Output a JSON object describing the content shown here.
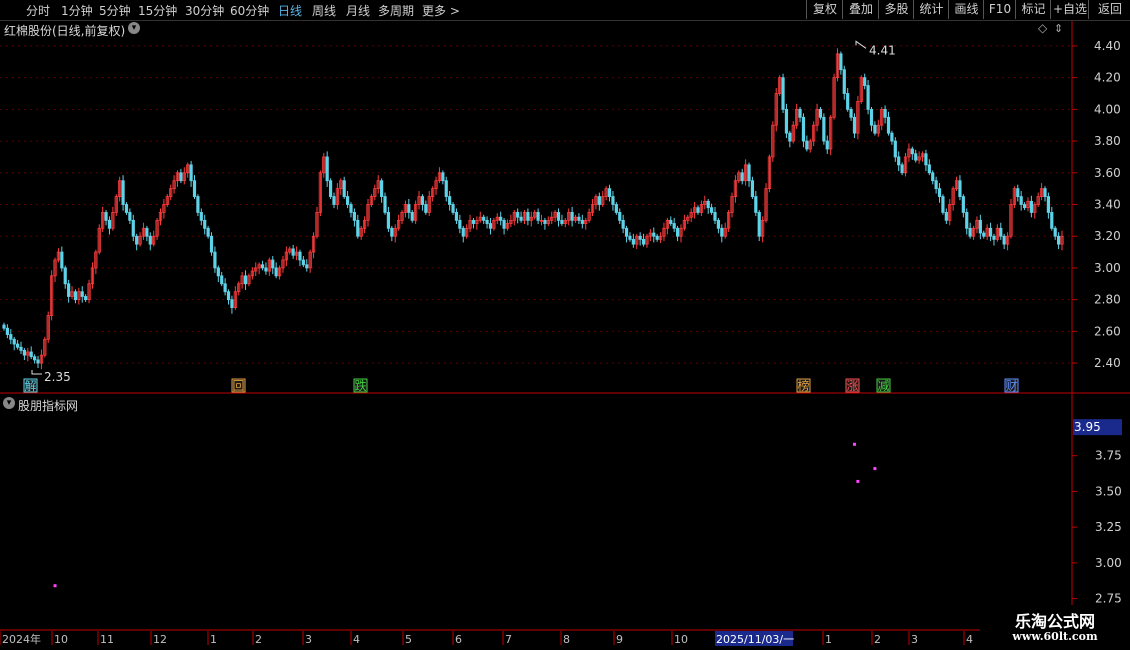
{
  "periods": [
    "分时",
    "1分钟",
    "5分钟",
    "15分钟",
    "30分钟",
    "60分钟",
    "日线",
    "周线",
    "月线",
    "多周期",
    "更多"
  ],
  "active_period": "日线",
  "more_arrow": ">",
  "right_buttons": [
    "复权",
    "叠加",
    "多股",
    "统计",
    "画线",
    "F10",
    "标记",
    "+自选",
    "返回"
  ],
  "main_title": "红棉股份(日线,前复权)",
  "sub_title": "股朋指标网",
  "colors": {
    "up": "#ff3c3c",
    "down": "#5fd3e8",
    "axis": "#c00000",
    "magenta": "#ff44ff",
    "highlight": "#1a2a8c"
  },
  "main_axis_labels": [
    "4.40",
    "4.20",
    "4.00",
    "3.80",
    "3.60",
    "3.40",
    "3.20",
    "3.00",
    "2.80",
    "2.60",
    "2.40"
  ],
  "sub_axis_labels": [
    "3.75",
    "3.50",
    "3.25",
    "3.00",
    "2.75"
  ],
  "sub_current_value": "3.95",
  "high_label": "4.41",
  "low_label": "2.35",
  "event_markers": [
    {
      "text": "解",
      "color": "#5fd3e8"
    },
    {
      "text": "回",
      "color": "#e0a040"
    },
    {
      "text": "跌",
      "color": "#40d040"
    },
    {
      "text": "榜",
      "color": "#e0a040"
    },
    {
      "text": "涨",
      "color": "#ff5050"
    },
    {
      "text": "减",
      "color": "#40d040"
    },
    {
      "text": "财",
      "color": "#6090ff"
    }
  ],
  "date_axis": [
    "2024年",
    "10",
    "11",
    "12",
    "1",
    "2",
    "3",
    "4",
    "5",
    "6",
    "7",
    "8",
    "9",
    "10",
    "2025/11/03/一",
    "1",
    "2",
    "3",
    "4"
  ],
  "watermark": {
    "title": "乐淘公式网",
    "url": "www.60lt.com"
  },
  "chart_data": [
    {
      "type": "candlestick",
      "title": "红棉股份(日线,前复权)",
      "ylim": [
        2.35,
        4.45
      ],
      "high": 4.41,
      "low": 2.35,
      "close_series": [
        2.62,
        2.58,
        2.55,
        2.52,
        2.5,
        2.48,
        2.45,
        2.47,
        2.44,
        2.42,
        2.4,
        2.45,
        2.55,
        2.7,
        2.95,
        3.05,
        3.1,
        3.0,
        2.9,
        2.82,
        2.85,
        2.8,
        2.85,
        2.82,
        2.8,
        2.9,
        3.0,
        3.1,
        3.25,
        3.35,
        3.3,
        3.25,
        3.35,
        3.45,
        3.55,
        3.4,
        3.35,
        3.3,
        3.2,
        3.15,
        3.2,
        3.25,
        3.2,
        3.15,
        3.2,
        3.3,
        3.35,
        3.4,
        3.45,
        3.5,
        3.55,
        3.6,
        3.55,
        3.6,
        3.65,
        3.55,
        3.45,
        3.35,
        3.3,
        3.25,
        3.2,
        3.1,
        3.0,
        2.95,
        2.9,
        2.85,
        2.8,
        2.75,
        2.85,
        2.9,
        2.95,
        2.9,
        2.95,
        2.98,
        3.0,
        3.02,
        3.0,
        2.98,
        3.05,
        3.0,
        2.95,
        3.0,
        3.05,
        3.1,
        3.12,
        3.08,
        3.1,
        3.05,
        3.02,
        3.0,
        3.1,
        3.2,
        3.35,
        3.6,
        3.7,
        3.55,
        3.45,
        3.4,
        3.5,
        3.55,
        3.45,
        3.4,
        3.35,
        3.3,
        3.2,
        3.25,
        3.3,
        3.4,
        3.45,
        3.5,
        3.55,
        3.45,
        3.35,
        3.25,
        3.2,
        3.25,
        3.3,
        3.35,
        3.4,
        3.35,
        3.3,
        3.4,
        3.45,
        3.4,
        3.35,
        3.45,
        3.5,
        3.55,
        3.6,
        3.55,
        3.45,
        3.4,
        3.35,
        3.3,
        3.25,
        3.2,
        3.25,
        3.3,
        3.28,
        3.3,
        3.32,
        3.3,
        3.28,
        3.25,
        3.3,
        3.32,
        3.3,
        3.25,
        3.28,
        3.3,
        3.35,
        3.32,
        3.3,
        3.35,
        3.3,
        3.32,
        3.35,
        3.3,
        3.3,
        3.28,
        3.3,
        3.32,
        3.35,
        3.3,
        3.28,
        3.3,
        3.35,
        3.3,
        3.32,
        3.3,
        3.28,
        3.3,
        3.35,
        3.4,
        3.45,
        3.4,
        3.45,
        3.5,
        3.45,
        3.4,
        3.35,
        3.3,
        3.25,
        3.2,
        3.18,
        3.15,
        3.2,
        3.18,
        3.15,
        3.2,
        3.22,
        3.2,
        3.18,
        3.2,
        3.25,
        3.3,
        3.28,
        3.25,
        3.2,
        3.25,
        3.3,
        3.32,
        3.35,
        3.38,
        3.35,
        3.4,
        3.42,
        3.38,
        3.35,
        3.3,
        3.25,
        3.2,
        3.25,
        3.35,
        3.45,
        3.55,
        3.6,
        3.55,
        3.65,
        3.55,
        3.45,
        3.35,
        3.2,
        3.3,
        3.5,
        3.7,
        3.9,
        4.1,
        4.2,
        4.0,
        3.85,
        3.8,
        3.9,
        4.0,
        3.95,
        3.8,
        3.75,
        3.8,
        3.9,
        4.0,
        3.95,
        3.8,
        3.75,
        3.95,
        4.2,
        4.35,
        4.25,
        4.1,
        4.0,
        3.95,
        3.85,
        4.05,
        4.2,
        4.15,
        4.0,
        3.9,
        3.85,
        3.9,
        4.0,
        3.95,
        3.85,
        3.8,
        3.7,
        3.65,
        3.6,
        3.7,
        3.75,
        3.72,
        3.68,
        3.7,
        3.72,
        3.65,
        3.6,
        3.55,
        3.5,
        3.45,
        3.35,
        3.3,
        3.4,
        3.5,
        3.55,
        3.45,
        3.35,
        3.25,
        3.2,
        3.25,
        3.3,
        3.22,
        3.2,
        3.25,
        3.2,
        3.18,
        3.25,
        3.2,
        3.15,
        3.2,
        3.4,
        3.5,
        3.45,
        3.4,
        3.38,
        3.42,
        3.35,
        3.4,
        3.45,
        3.5,
        3.45,
        3.35,
        3.25,
        3.2,
        3.15,
        3.2
      ]
    },
    {
      "type": "scatter",
      "title": "股朋指标网",
      "ylim": [
        2.6,
        4.0
      ],
      "current_value": 3.95,
      "points": [
        {
          "index": 15,
          "y": 2.84
        },
        {
          "index": 250,
          "y": 3.83
        },
        {
          "index": 251,
          "y": 3.57
        },
        {
          "index": 256,
          "y": 3.66
        }
      ]
    }
  ]
}
